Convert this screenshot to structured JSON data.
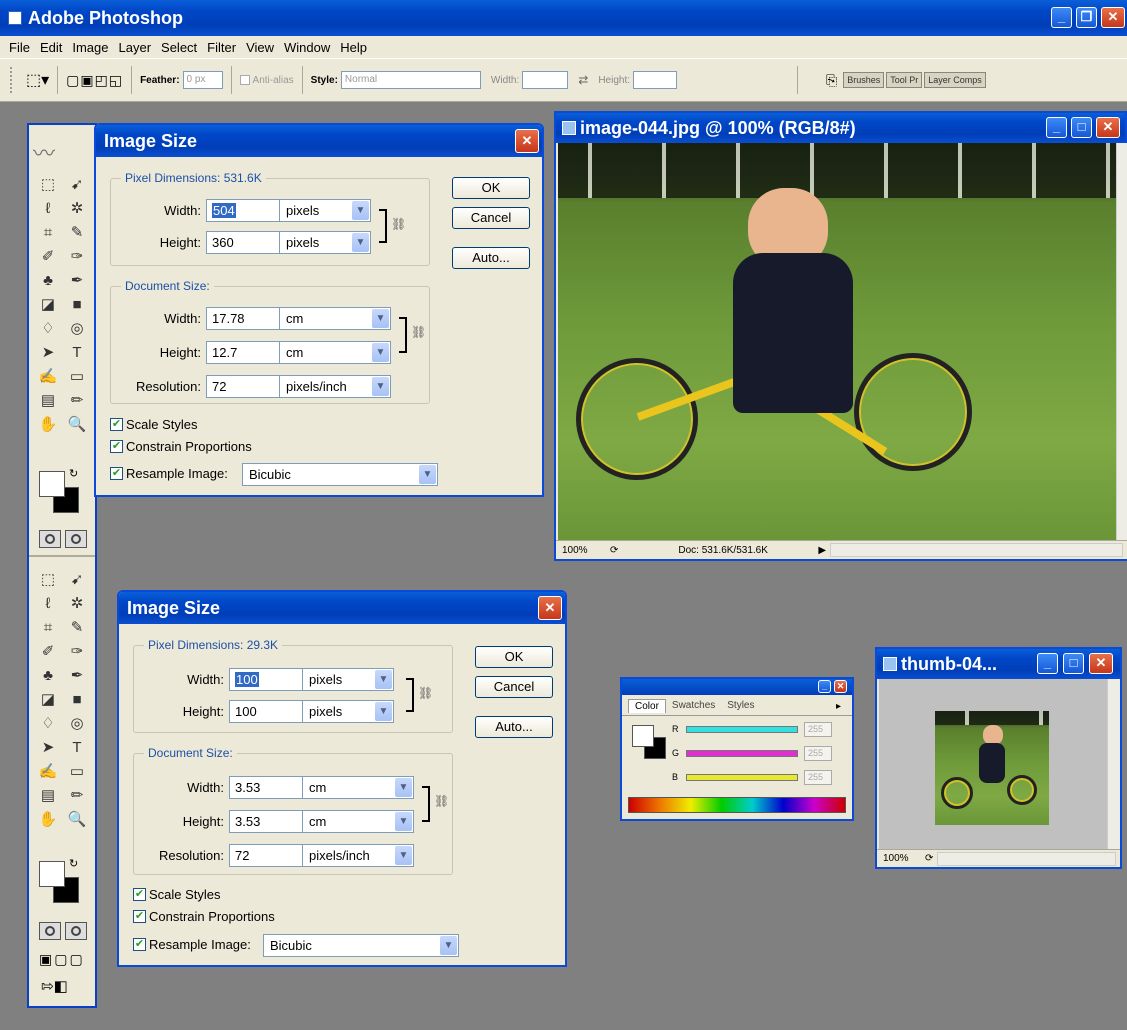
{
  "app": {
    "title": "Adobe Photoshop",
    "menu": [
      "File",
      "Edit",
      "Image",
      "Layer",
      "Select",
      "Filter",
      "View",
      "Window",
      "Help"
    ]
  },
  "options": {
    "feather_label": "Feather:",
    "feather_value": "0 px",
    "antialias_label": "Anti-alias",
    "style_label": "Style:",
    "style_value": "Normal",
    "width_label": "Width:",
    "height_label": "Height:",
    "palette_tabs": [
      "Brushes",
      "Tool Pr",
      "Layer Comps"
    ]
  },
  "dialog1": {
    "title": "Image Size",
    "pixel_dimensions": "Pixel Dimensions:  531.6K",
    "width_label": "Width:",
    "width_value": "504",
    "height_label": "Height:",
    "height_value": "360",
    "pixel_unit": "pixels",
    "document_size": "Document Size:",
    "doc_width_value": "17.78",
    "doc_height_value": "12.7",
    "doc_unit": "cm",
    "resolution_label": "Resolution:",
    "resolution_value": "72",
    "resolution_unit": "pixels/inch",
    "scale_styles": "Scale Styles",
    "constrain": "Constrain Proportions",
    "resample": "Resample Image:",
    "resample_value": "Bicubic",
    "ok": "OK",
    "cancel": "Cancel",
    "auto": "Auto..."
  },
  "dialog2": {
    "title": "Image Size",
    "pixel_dimensions": "Pixel Dimensions:  29.3K",
    "width_label": "Width:",
    "width_value": "100",
    "height_label": "Height:",
    "height_value": "100",
    "pixel_unit": "pixels",
    "document_size": "Document Size:",
    "doc_width_value": "3.53",
    "doc_height_value": "3.53",
    "doc_unit": "cm",
    "resolution_label": "Resolution:",
    "resolution_value": "72",
    "resolution_unit": "pixels/inch",
    "scale_styles": "Scale Styles",
    "constrain": "Constrain Proportions",
    "resample": "Resample Image:",
    "resample_value": "Bicubic",
    "ok": "OK",
    "cancel": "Cancel",
    "auto": "Auto..."
  },
  "docwin1": {
    "title": "image-044.jpg @ 100% (RGB/8#)",
    "zoom": "100%",
    "doc_info": "Doc: 531.6K/531.6K"
  },
  "docwin2": {
    "title": "thumb-04...",
    "zoom": "100%"
  },
  "colorpal": {
    "tabs": [
      "Color",
      "Swatches",
      "Styles"
    ],
    "channels": [
      {
        "label": "R",
        "value": "255",
        "color": "#33e0e0"
      },
      {
        "label": "G",
        "value": "255",
        "color": "#e030d0"
      },
      {
        "label": "B",
        "value": "255",
        "color": "#e8e830"
      }
    ]
  }
}
